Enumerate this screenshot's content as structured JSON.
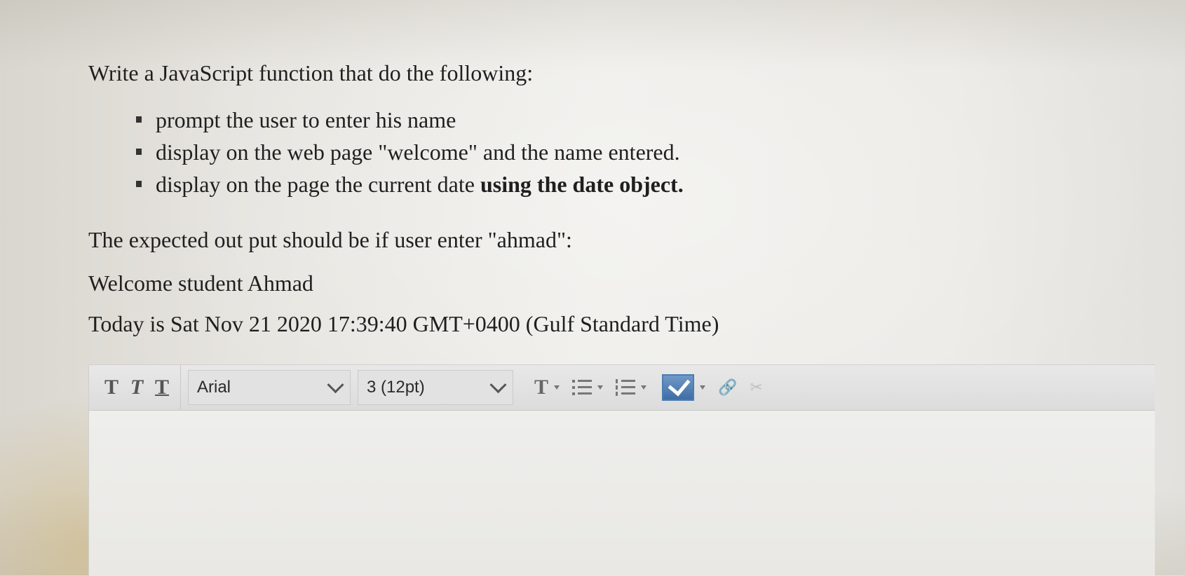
{
  "question": {
    "heading": "Write a JavaScript function that do the following:",
    "tasks": [
      {
        "text": "prompt the user to enter his name",
        "bold": ""
      },
      {
        "text": "display on the web page \"welcome\" and the name entered.",
        "bold": ""
      },
      {
        "text": "display on the page the current date ",
        "bold": "using the date object."
      }
    ],
    "expected_intro": "The expected out put should be if user enter \"ahmad\":",
    "output_line1": "Welcome student Ahmad",
    "output_line2": "Today is Sat Nov 21 2020 17:39:40 GMT+0400 (Gulf Standard Time)"
  },
  "toolbar": {
    "text_style_buttons": [
      "T",
      "T",
      "T"
    ],
    "font_family": "Arial",
    "font_size": "3 (12pt)",
    "text_color_label": "T",
    "icons": {
      "bold": "text-bold-icon",
      "italic": "text-italic-icon",
      "underline": "text-underline-icon",
      "text_color": "text-color-icon",
      "bullet_list": "bullet-list-icon",
      "numbered_list": "numbered-list-icon",
      "spellcheck": "spellcheck-icon",
      "link": "link-icon",
      "unlink": "unlink-icon"
    },
    "colors": {
      "spellcheck_accent": "#4d7cb3",
      "disabled_icon": "#bdbdbd"
    }
  }
}
